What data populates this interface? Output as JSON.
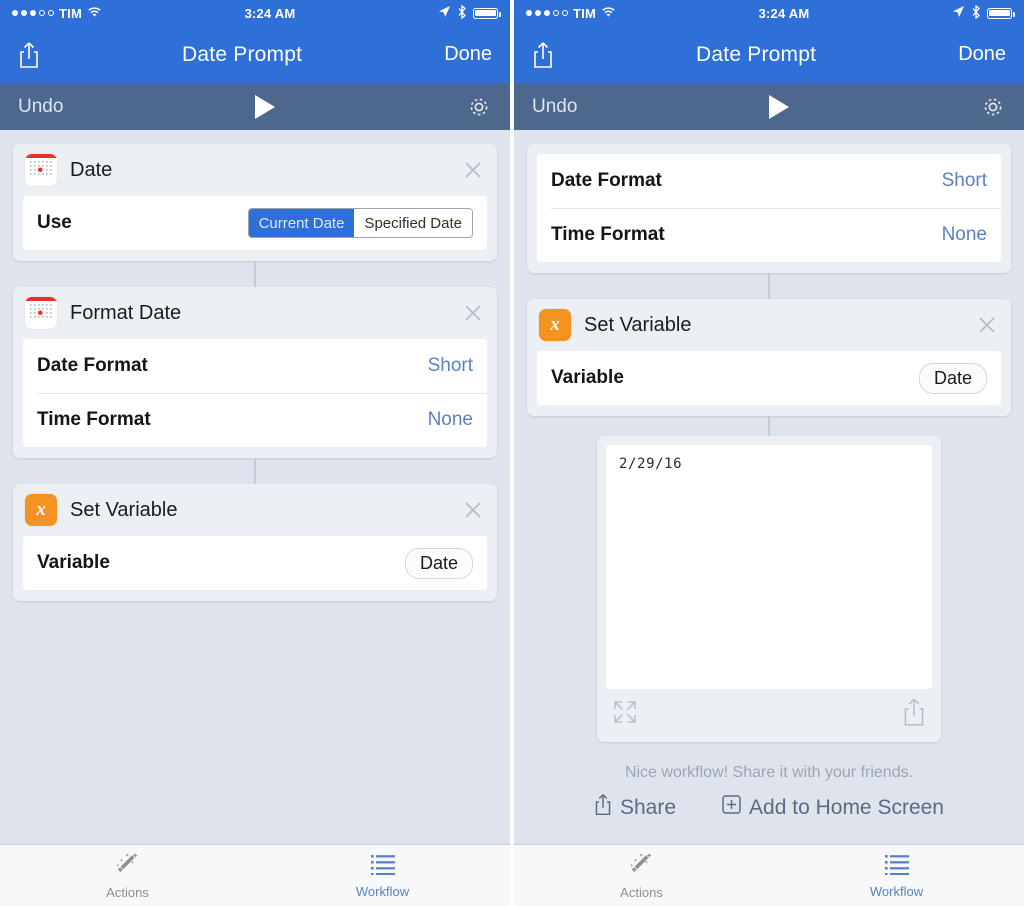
{
  "status_bar": {
    "signal_filled": 3,
    "signal_empty": 2,
    "carrier": "TIM",
    "wifi_icon": "wifi-icon",
    "time": "3:24 AM",
    "location_icon": "location-arrow-icon",
    "bluetooth_icon": "bluetooth-icon",
    "battery_icon": "battery-full-icon"
  },
  "nav_bar": {
    "share_icon": "share-icon",
    "title": "Date Prompt",
    "done_label": "Done"
  },
  "toolbar": {
    "undo_label": "Undo",
    "play_icon": "play-icon",
    "settings_icon": "gear-icon"
  },
  "colors": {
    "nav_blue": "#2f6fd8",
    "toolbar_blue": "#4e688d",
    "canvas": "#dfe4ec",
    "card": "#eceff4",
    "accent_value": "#5b7fc4",
    "calendar_red": "#e5342c",
    "variable_orange": "#f59322"
  },
  "left_panel": {
    "cards": [
      {
        "icon": "calendar-icon",
        "title": "Date",
        "close_icon": "close-icon",
        "rows": [
          {
            "label": "Use",
            "type": "segmented",
            "options": [
              "Current Date",
              "Specified Date"
            ],
            "selected": "Current Date"
          }
        ]
      },
      {
        "icon": "calendar-icon",
        "title": "Format Date",
        "close_icon": "close-icon",
        "rows": [
          {
            "label": "Date Format",
            "type": "value",
            "value": "Short"
          },
          {
            "label": "Time Format",
            "type": "value",
            "value": "None"
          }
        ]
      },
      {
        "icon": "variable-x-icon",
        "title": "Set Variable",
        "close_icon": "close-icon",
        "rows": [
          {
            "label": "Variable",
            "type": "pill",
            "value": "Date"
          }
        ]
      }
    ]
  },
  "right_panel": {
    "format_card": {
      "rows": [
        {
          "label": "Date Format",
          "value": "Short"
        },
        {
          "label": "Time Format",
          "value": "None"
        }
      ]
    },
    "set_variable_card": {
      "icon": "variable-x-icon",
      "title": "Set Variable",
      "close_icon": "close-icon",
      "row_label": "Variable",
      "row_value": "Date"
    },
    "result": {
      "output_text": "2/29/16",
      "expand_icon": "expand-icon",
      "share_icon": "share-icon"
    },
    "promo": {
      "message": "Nice workflow! Share it with your friends.",
      "share_icon": "share-icon",
      "share_label": "Share",
      "add_icon": "plus-box-icon",
      "add_label": "Add to Home Screen"
    }
  },
  "tab_bar": {
    "tabs": [
      {
        "icon": "magic-wand-icon",
        "label": "Actions",
        "active": false
      },
      {
        "icon": "list-icon",
        "label": "Workflow",
        "active": true
      }
    ]
  }
}
